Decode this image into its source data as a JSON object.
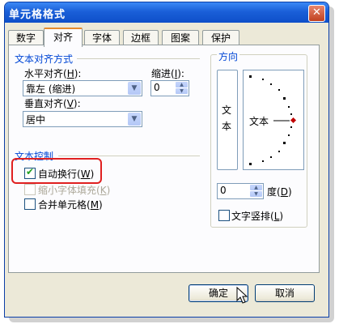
{
  "dialog": {
    "title": "单元格格式",
    "close_glyph": "✕"
  },
  "tabs": [
    "数字",
    "对齐",
    "字体",
    "边框",
    "图案",
    "保护"
  ],
  "active_tab": "对齐",
  "text_alignment": {
    "heading": "文本对齐方式",
    "horizontal_label": "水平对齐(",
    "horizontal_key": "H",
    "horizontal_value": "靠左 (缩进)",
    "indent_label": "缩进(",
    "indent_key": "I",
    "indent_value": "0",
    "vertical_label": "垂直对齐(",
    "vertical_key": "V",
    "vertical_value": "居中"
  },
  "text_control": {
    "heading": "文本控制",
    "wrap_text": {
      "label": "自动换行(",
      "key": "W",
      "checked": true
    },
    "shrink_to_fit": {
      "label": "缩小字体填充(",
      "key": "K",
      "checked": false,
      "enabled": false
    },
    "merge_cells": {
      "label": "合并单元格(",
      "key": "M",
      "checked": false
    }
  },
  "orientation": {
    "heading": "方向",
    "vertical_text_1": "文",
    "vertical_text_2": "本",
    "dial_text": "文本",
    "degree_value": "0",
    "degree_label": "度(",
    "degree_key": "D",
    "vertical_text_option": {
      "label": "文字竖排(",
      "key": "L",
      "checked": false
    }
  },
  "buttons": {
    "ok": "确定",
    "cancel": "取消"
  },
  "colors": {
    "title_bar": "#1a5fd8",
    "section_heading": "#0046d5",
    "highlight": "#e02020",
    "dial_marker": "#c00000"
  }
}
